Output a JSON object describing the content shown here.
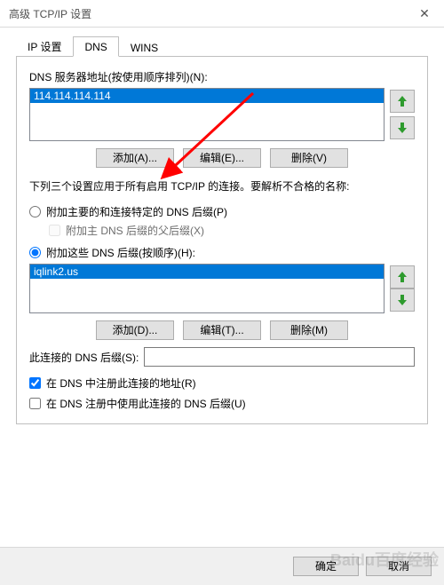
{
  "window": {
    "title": "高级 TCP/IP 设置"
  },
  "tabs": {
    "ip": "IP 设置",
    "dns": "DNS",
    "wins": "WINS"
  },
  "dns_servers": {
    "label": "DNS 服务器地址(按使用顺序排列)(N):",
    "item": "114.114.114.114",
    "add": "添加(A)...",
    "edit": "编辑(E)...",
    "remove": "删除(V)"
  },
  "desc": "下列三个设置应用于所有启用 TCP/IP 的连接。要解析不合格的名称:",
  "opt": {
    "primary": "附加主要的和连接特定的 DNS 后缀(P)",
    "parent": "附加主 DNS 后缀的父后缀(X)",
    "these": "附加这些 DNS 后缀(按顺序)(H):"
  },
  "suffix": {
    "item": "iqlink2.us",
    "add": "添加(D)...",
    "edit": "编辑(T)...",
    "remove": "删除(M)"
  },
  "conn_suffix_label": "此连接的 DNS 后缀(S):",
  "reg_addr": "在 DNS 中注册此连接的地址(R)",
  "use_suffix": "在 DNS 注册中使用此连接的 DNS 后缀(U)",
  "buttons": {
    "ok": "确定",
    "cancel": "取消"
  },
  "watermark": "Baidu百度经验"
}
